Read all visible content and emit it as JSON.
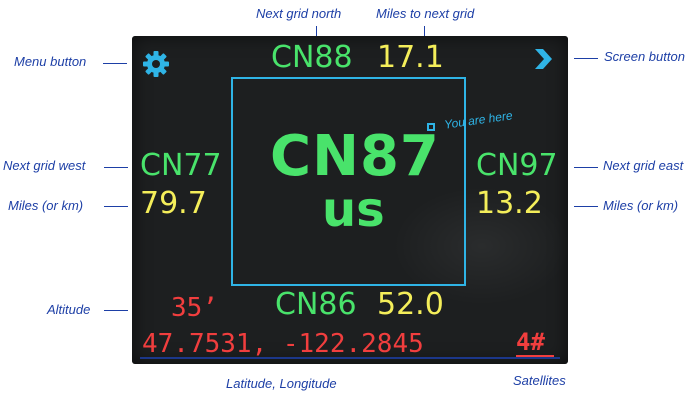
{
  "screen": {
    "main_grid": "CN87",
    "sub_grid": "us",
    "here_label": "You are here",
    "north": {
      "grid": "CN88",
      "distance": "17.1"
    },
    "west": {
      "grid": "CN77",
      "distance": "79.7"
    },
    "east": {
      "grid": "CN97",
      "distance": "13.2"
    },
    "south": {
      "grid": "CN86",
      "distance": "52.0"
    },
    "altitude": "35’",
    "coordinates": "47.7531, -122.2845",
    "satellites": "4#",
    "icons": {
      "menu": "gear-icon",
      "screen": "chevron-right-icon"
    }
  },
  "callouts": {
    "next_grid_north": "Next grid north",
    "miles_to_next_grid": "Miles to next grid",
    "menu_button": "Menu button",
    "screen_button": "Screen button",
    "next_grid_west": "Next grid west",
    "next_grid_east": "Next grid east",
    "miles_left": "Miles (or km)",
    "miles_right": "Miles (or km)",
    "altitude": "Altitude",
    "lat_long": "Latitude, Longitude",
    "satellites": "Satellites"
  },
  "colors": {
    "callout": "#1d3fa6",
    "grid_text": "#49e36b",
    "distance_text": "#f4ee5a",
    "status_text": "#f13e3e",
    "accent": "#2fb4e6",
    "screen_bg": "#1d1f20"
  }
}
